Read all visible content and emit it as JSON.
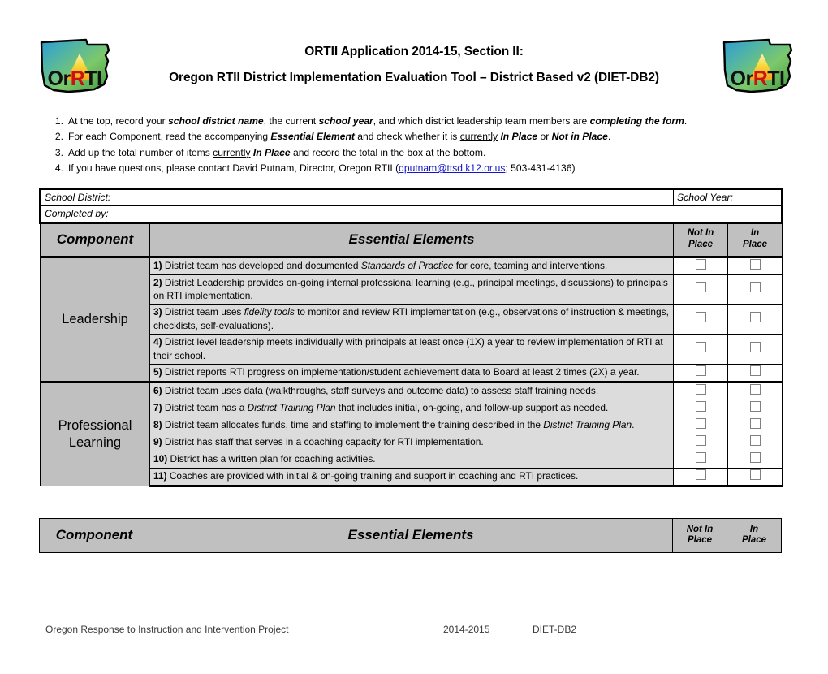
{
  "header": {
    "title_line1": "ORTII Application 2014-15, Section II:",
    "title_line2": "Oregon RTII District Implementation Evaluation Tool – District Based v2 (DIET-DB2)",
    "logo_text": "OrRTI",
    "logo_name": "orrti-oregon-logo"
  },
  "instructions": [
    {
      "num": "1.",
      "html": "At the top, record your <span class=\"bi\">school district name</span>, the current <span class=\"bi\">school year</span>, and which district leadership team members are <span class=\"bi\">completing the form</span>."
    },
    {
      "num": "2.",
      "html": "For each Component, read the accompanying <span class=\"bi\">Essential Element</span> and check whether it is <span class=\"u\">currently</span> <span class=\"bi\">In Place</span> or <span class=\"bi\">Not in Place</span>."
    },
    {
      "num": "3.",
      "html": "Add up the total number of items <span class=\"u\">currently</span> <span class=\"bi\">In Place</span> and record the total in the box at the bottom."
    },
    {
      "num": "4.",
      "html": "If you have questions, please contact David Putnam, Director, Oregon RTII (<span class=\"maillink\">dputnam@ttsd.k12.or.us</span>; 503-431-4136)"
    }
  ],
  "meta": {
    "school_district_label": "School District:",
    "school_district_value": "",
    "school_year_label": "School Year:",
    "school_year_value": "",
    "completed_by_label": "Completed by:",
    "completed_by_value": ""
  },
  "table_headers": {
    "component": "Component",
    "essential_elements": "Essential Elements",
    "not_in_place_l1": "Not In",
    "not_in_place_l2": "Place",
    "in_place_l1": "In",
    "in_place_l2": "Place"
  },
  "sections": [
    {
      "component": "Leadership",
      "rows": [
        {
          "num": "1)",
          "html": "District team has developed and documented <i>Standards of Practice</i> for core, teaming and interventions.",
          "not_in_place": false,
          "in_place": false
        },
        {
          "num": "2)",
          "html": "District Leadership provides on-going internal professional learning (e.g., principal meetings, discussions) to principals on RTI implementation.",
          "not_in_place": false,
          "in_place": false
        },
        {
          "num": "3)",
          "html": "District team uses <i>fidelity tools</i> to monitor and review RTI implementation (e.g., observations of instruction &amp; meetings, checklists, self-evaluations).",
          "not_in_place": false,
          "in_place": false
        },
        {
          "num": "4)",
          "html": "District level leadership meets individually with principals at least once (1X) a year to review implementation of RTI at their school.",
          "not_in_place": false,
          "in_place": false
        },
        {
          "num": "5)",
          "html": "District reports RTI progress on implementation/student achievement data to Board at least 2 times (2X) a year.",
          "not_in_place": false,
          "in_place": false
        }
      ]
    },
    {
      "component": "Professional Learning",
      "component_l1": "Professional",
      "component_l2": "Learning",
      "rows": [
        {
          "num": "6)",
          "html": "District team uses data (walkthroughs, staff surveys and outcome data) to assess staff training needs.",
          "not_in_place": false,
          "in_place": false
        },
        {
          "num": "7)",
          "html": "District team has a <i>District Training Plan</i> that includes initial, on-going, and follow-up support as needed.",
          "not_in_place": false,
          "in_place": false
        },
        {
          "num": "8)",
          "html": "District team allocates funds, time and staffing to implement the training described in the <i>District Training Plan</i>.",
          "not_in_place": false,
          "in_place": false
        },
        {
          "num": "9)",
          "html": "District has staff that serves in a coaching capacity for RTI implementation.",
          "not_in_place": false,
          "in_place": false
        },
        {
          "num": "10)",
          "html": "District has a written plan for coaching activities.",
          "not_in_place": false,
          "in_place": false
        },
        {
          "num": "11)",
          "html": "Coaches are provided with initial &amp; on-going training and support in coaching and RTI practices.",
          "not_in_place": false,
          "in_place": false
        }
      ]
    }
  ],
  "footer": {
    "left": "Oregon Response to Instruction and Intervention Project",
    "middle": "2014-2015",
    "right": "DIET-DB2"
  },
  "colors": {
    "header_band": "#c0c0c0",
    "row_fill": "#dcdcdc",
    "link": "#1414c8",
    "border": "#000000"
  }
}
